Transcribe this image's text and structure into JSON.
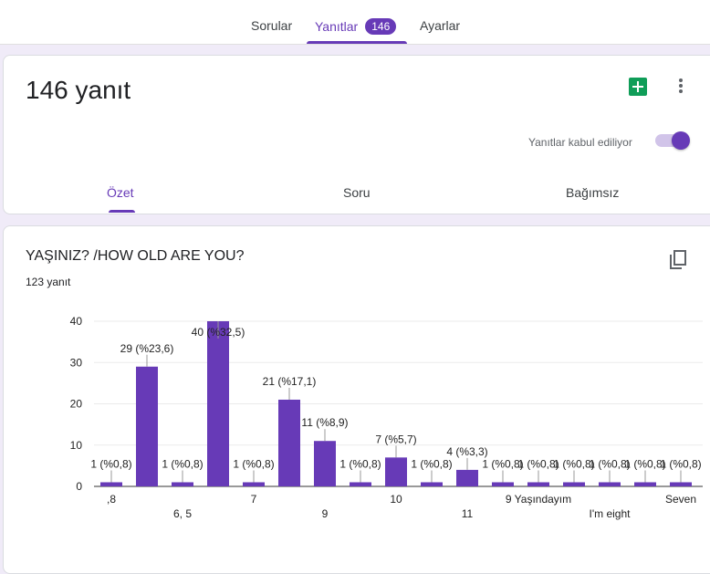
{
  "topbar": {
    "tabs": [
      {
        "label": "Sorular"
      },
      {
        "label": "Yanıtlar",
        "badge": "146"
      },
      {
        "label": "Ayarlar"
      }
    ]
  },
  "summary": {
    "title": "146 yanıt",
    "accepting_label": "Yanıtlar kabul ediliyor",
    "accepting": true,
    "tabs": [
      {
        "label": "Özet"
      },
      {
        "label": "Soru"
      },
      {
        "label": "Bağımsız"
      }
    ]
  },
  "question": {
    "title": "YAŞINIZ? /HOW OLD ARE YOU?",
    "count": "123 yanıt"
  },
  "colors": {
    "accent": "#673ab7",
    "sheets": "#0f9d58",
    "background": "#f0ebf8"
  },
  "chart_data": {
    "type": "bar",
    "categories": [
      ",8",
      "",
      "6, 5",
      "",
      "7",
      "",
      "9",
      "",
      "10",
      "",
      "11",
      "",
      "9 Yaşındayım",
      "",
      "I'm eight",
      "",
      "Seven"
    ],
    "values": [
      1,
      29,
      1,
      40,
      1,
      21,
      11,
      1,
      7,
      1,
      4,
      1,
      1,
      1,
      1,
      1,
      1
    ],
    "data_labels": [
      "1 (%0,8)",
      "29 (%23,6)",
      "1 (%0,8)",
      "40 (%32,5)",
      "1 (%0,8)",
      "21 (%17,1)",
      "11 (%8,9)",
      "1 (%0,8)",
      "7 (%5,7)",
      "1 (%0,8)",
      "4 (%3,3)",
      "1 (%0,8)",
      "1 (%0,8)",
      "1 (%0,8)",
      "1 (%0,8)",
      "1 (%0,8)",
      "1 (%0,8)"
    ],
    "yticks": [
      "0",
      "10",
      "20",
      "30",
      "40"
    ],
    "ylim": [
      0,
      40
    ],
    "grid": true,
    "legend": "none"
  }
}
